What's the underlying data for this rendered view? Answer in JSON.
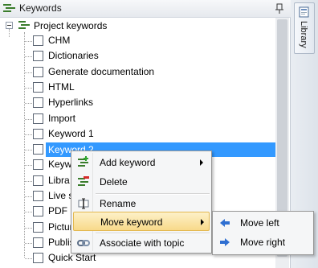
{
  "panel": {
    "title": "Keywords",
    "title_icon": "keywords-icon",
    "pin_icon": "pin-icon"
  },
  "dock": {
    "library_tab_label": "Library",
    "library_icon": "library-book-icon"
  },
  "tree": {
    "root_label": "Project keywords",
    "root_icon": "keywords-list-icon",
    "items": [
      {
        "label": "CHM"
      },
      {
        "label": "Dictionaries"
      },
      {
        "label": "Generate documentation"
      },
      {
        "label": "HTML"
      },
      {
        "label": "Hyperlinks"
      },
      {
        "label": "Import"
      },
      {
        "label": "Keyword 1"
      },
      {
        "label": "Keyword 2",
        "selected": true
      },
      {
        "label": "Keyw"
      },
      {
        "label": "Libra"
      },
      {
        "label": "Live s"
      },
      {
        "label": "PDF"
      },
      {
        "label": "Pictur"
      },
      {
        "label": "Publis"
      },
      {
        "label": "Quick Start"
      }
    ]
  },
  "context_menu": {
    "items": [
      {
        "label": "Add keyword",
        "icon": "add-keyword-icon",
        "has_submenu": true
      },
      {
        "label": "Delete",
        "icon": "delete-keyword-icon"
      },
      {
        "label": "Rename",
        "icon": "rename-icon"
      },
      {
        "label": "Move keyword",
        "has_submenu": true,
        "highlighted": true
      },
      {
        "label": "Associate with topic",
        "icon": "link-icon"
      }
    ]
  },
  "submenu": {
    "items": [
      {
        "label": "Move left",
        "icon": "arrow-left-icon"
      },
      {
        "label": "Move right",
        "icon": "arrow-right-icon"
      }
    ]
  },
  "colors": {
    "selection": "#3399ff",
    "menu_highlight": "#f8d98a",
    "arrow_blue": "#2f6fd1"
  }
}
